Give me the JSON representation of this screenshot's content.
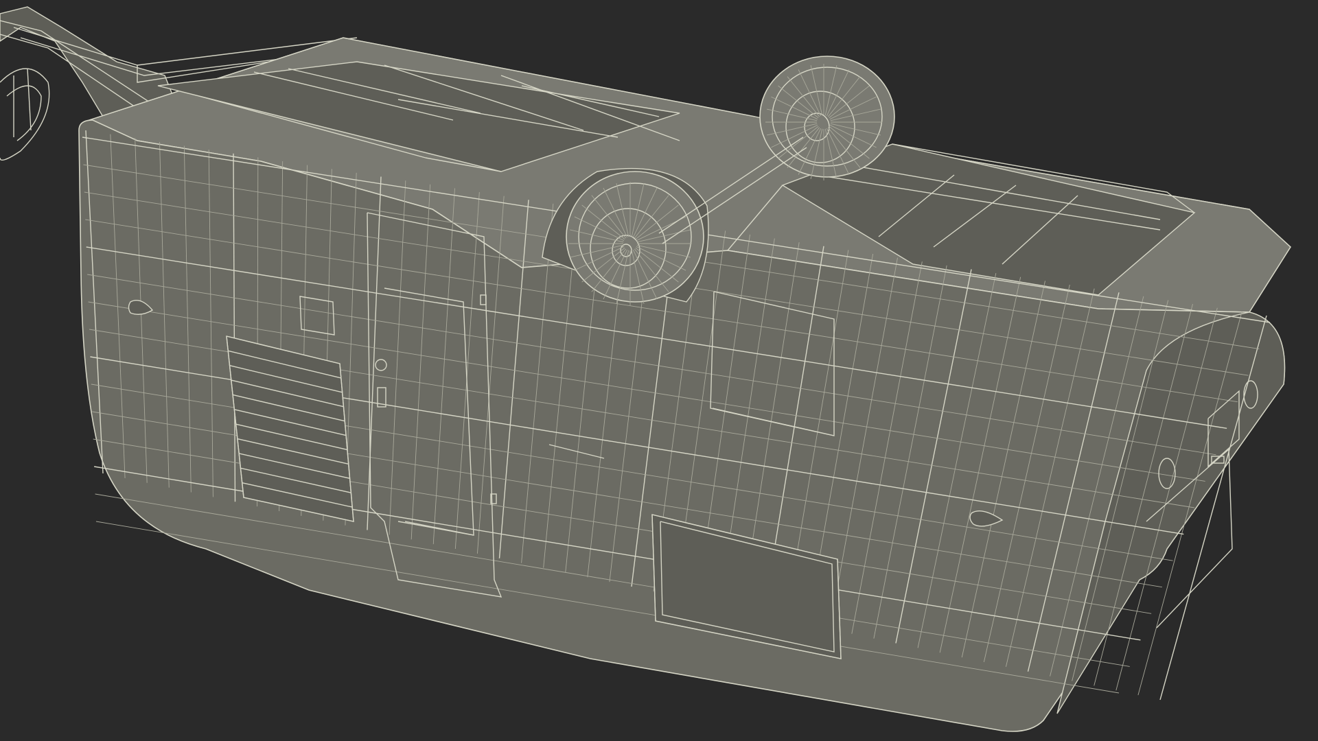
{
  "scene": {
    "background": "#2a2a2a",
    "surface_color": "#6b6b63",
    "surface_dark": "#5e5e57",
    "surface_light": "#7a7a72",
    "wire_color": "#d6d6c6",
    "wire_faint": "#a9a99b"
  }
}
